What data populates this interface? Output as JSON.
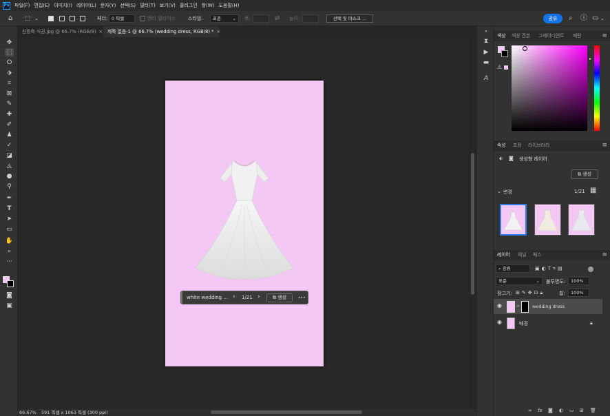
{
  "menubar": {
    "app_icon": "Ps",
    "items": [
      "파일(F)",
      "편집(E)",
      "이미지(I)",
      "레이어(L)",
      "문자(Y)",
      "선택(S)",
      "필터(T)",
      "보기(V)",
      "플러그인",
      "창(W)",
      "도움말(H)"
    ]
  },
  "options": {
    "feather_label": "페더:",
    "feather_value": "0 픽셀",
    "antialias_label": "앤티 앨리어스",
    "style_label": "스타일:",
    "style_value": "표준",
    "width_label": "폭:",
    "height_label": "높이:",
    "select_mask_button": "선택 및 마스크 ...",
    "share_button": "공유"
  },
  "tabs": [
    {
      "label": "신랑측 식권.jpg @ 66.7% (RGB/8)",
      "close": "×"
    },
    {
      "label": "제목 없음-1 @ 66.7% (wedding dress, RGB/8) *",
      "close": "×"
    }
  ],
  "contextbar": {
    "prompt": "white wedding ...",
    "counter": "1/21",
    "prev": "‹",
    "next": "›",
    "generate": "생성",
    "more": "•••"
  },
  "status": {
    "zoom": "66.67%",
    "doc_info": "591 픽셀 x 1063 픽셀 (300 ppi)",
    "arrow": "›"
  },
  "color_panel": {
    "tabs": [
      "색상",
      "색상 견본",
      "그레이디언트",
      "패턴"
    ],
    "foreground": "#f4c8f4",
    "background": "#000000"
  },
  "properties_panel": {
    "tabs": [
      "속성",
      "조정",
      "라이브러리"
    ],
    "layer_type": "생성형 레이어",
    "generate_button": "생성",
    "variations_label": "변경",
    "variations_count": "1/21"
  },
  "layers_panel": {
    "tabs": [
      "레이어",
      "채널",
      "패스"
    ],
    "filter_kind": "종류",
    "blend_mode": "표준",
    "opacity_label": "불투명도:",
    "opacity_value": "100%",
    "lock_label": "잠그기:",
    "fill_label": "칠:",
    "fill_value": "100%",
    "layers": [
      {
        "name": "wedding dress",
        "selected": true
      },
      {
        "name": "배경",
        "locked": true
      }
    ]
  }
}
